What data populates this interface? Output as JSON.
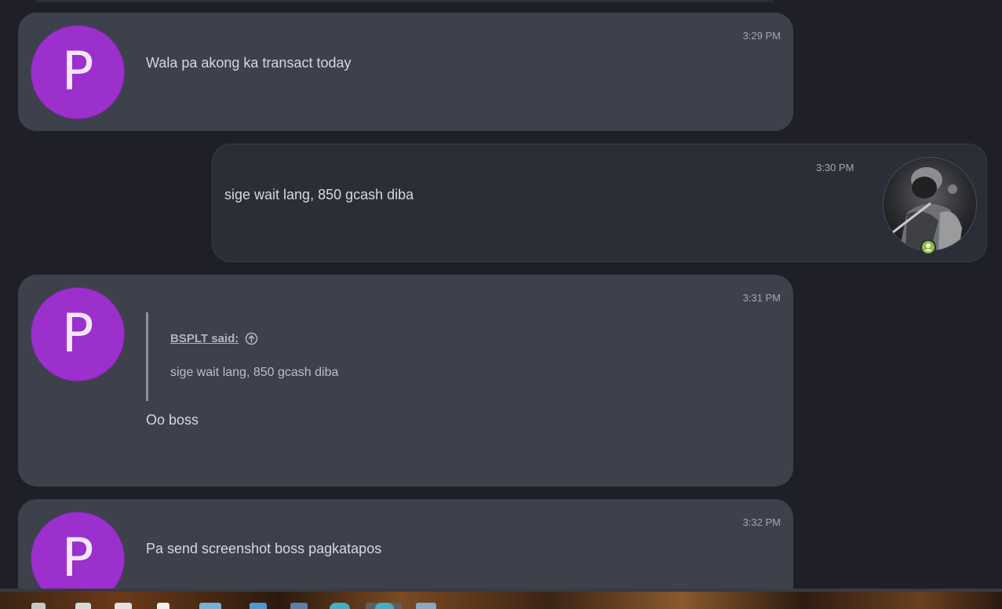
{
  "messages": [
    {
      "direction": "incoming",
      "avatar_letter": "P",
      "time": "3:29 PM",
      "text": "Wala pa akong ka transact today"
    },
    {
      "direction": "outgoing",
      "time": "3:30 PM",
      "text": "sige wait lang, 850 gcash diba",
      "avatar_icon": "user-photo-avatar",
      "status_icon": "online-user-icon"
    },
    {
      "direction": "incoming",
      "avatar_letter": "P",
      "time": "3:31 PM",
      "quote": {
        "author": "BSPLT said:",
        "jump_icon": "arrow-up-circle-icon",
        "text": "sige wait lang, 850 gcash diba"
      },
      "text": "Oo boss"
    },
    {
      "direction": "incoming",
      "avatar_letter": "P",
      "time": "3:32 PM",
      "text": "Pa send screenshot boss pagkatapos"
    }
  ],
  "colors": {
    "background": "#1f2027",
    "incoming_bubble": "#3d414b",
    "outgoing_bubble": "#2c2e37",
    "avatar_purple": "#9b30cc",
    "online_green": "#8fbe3f"
  }
}
